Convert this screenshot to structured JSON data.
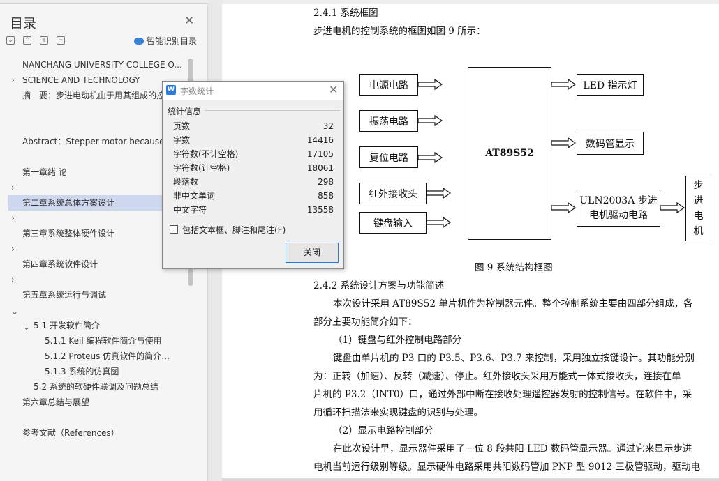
{
  "toc": {
    "title": "目录",
    "smart_label": "智能识别目录",
    "items": [
      {
        "label": "NANCHANG UNIVERSITY COLLEGE O..."
      },
      {
        "label": "SCIENCE AND TECHNOLOGY"
      },
      {
        "label": "摘　要：步进电动机由于用其组成的控"
      },
      {
        "label": "Abstract：Stepper motor because o"
      },
      {
        "label": "第一章绪  论"
      },
      {
        "label": "第二章系统总体方案设计"
      },
      {
        "label": "第三章系统整体硬件设计"
      },
      {
        "label": "第四章系统软件设计"
      },
      {
        "label": "第五章系统运行与调试"
      },
      {
        "label": "5.1 开发软件简介"
      },
      {
        "label": "5.1.1 Keil 编程软件简介与使用"
      },
      {
        "label": "5.1.2 Proteus 仿真软件的简介与..."
      },
      {
        "label": "5.1.3 系统的仿真图"
      },
      {
        "label": "5.2 系统的软硬件联调及问题总结"
      },
      {
        "label": "第六章总结与展望"
      },
      {
        "label": "参考文献（References）"
      }
    ]
  },
  "document": {
    "heading_241": "2.4.1 系统框图",
    "intro": "步进电机的控制系统的框图如图 9 所示：",
    "diagram": {
      "inputs": [
        "电源电路",
        "振荡电路",
        "复位电路",
        "红外接收头",
        "键盘输入"
      ],
      "center": "AT89S52",
      "outputs": [
        "LED 指示灯",
        "数码管显示"
      ],
      "driver_line1": "ULN2003A 步进",
      "driver_line2": "电机驱动电路",
      "motor_chars": [
        "步",
        "进",
        "电",
        "机"
      ]
    },
    "figure_caption": "图 9  系统结构框图",
    "heading_242": "2.4.2  系统设计方案与功能简述",
    "lines": [
      "本次设计采用 AT89S52 单片机作为控制器元件。整个控制系统主要由四部分组成，各",
      "部分主要功能简介如下：",
      "（1）键盘与红外控制电路部分",
      "键盘由单片机的 P3 口的 P3.5、P3.6、P3.7 来控制，采用独立按键设计。其功能分别",
      "为：正转（加速）、反转（减速）、停止。红外接收头采用万能式一体式接收头，连接在单",
      "片机的 P3.2（INT0）口，通过外部中断在接收处理遥控器发射的控制信号。在软件中，采",
      "用循环扫描法来实现键盘的识别与处理。",
      "（2）显示电路控制部分",
      "在此次设计里，显示器件采用了一位 8 段共阳 LED 数码管显示器。通过它来显示步进",
      "电机当前运行级别等级。显示硬件电路采用共阳数码管加 PNP 型 9012 三极管驱动，驱动电"
    ]
  },
  "dialog": {
    "title": "字数统计",
    "group_label": "统计信息",
    "stats": [
      {
        "label": "页数",
        "value": "32"
      },
      {
        "label": "字数",
        "value": "14416"
      },
      {
        "label": "字符数(不计空格)",
        "value": "17105"
      },
      {
        "label": "字符数(计空格)",
        "value": "18061"
      },
      {
        "label": "段落数",
        "value": "298"
      },
      {
        "label": "非中文单词",
        "value": "858"
      },
      {
        "label": "中文字符",
        "value": "13558"
      }
    ],
    "checkbox_label": "包括文本框、脚注和尾注(F)",
    "checkbox_checked": false,
    "close_label": "关闭"
  }
}
